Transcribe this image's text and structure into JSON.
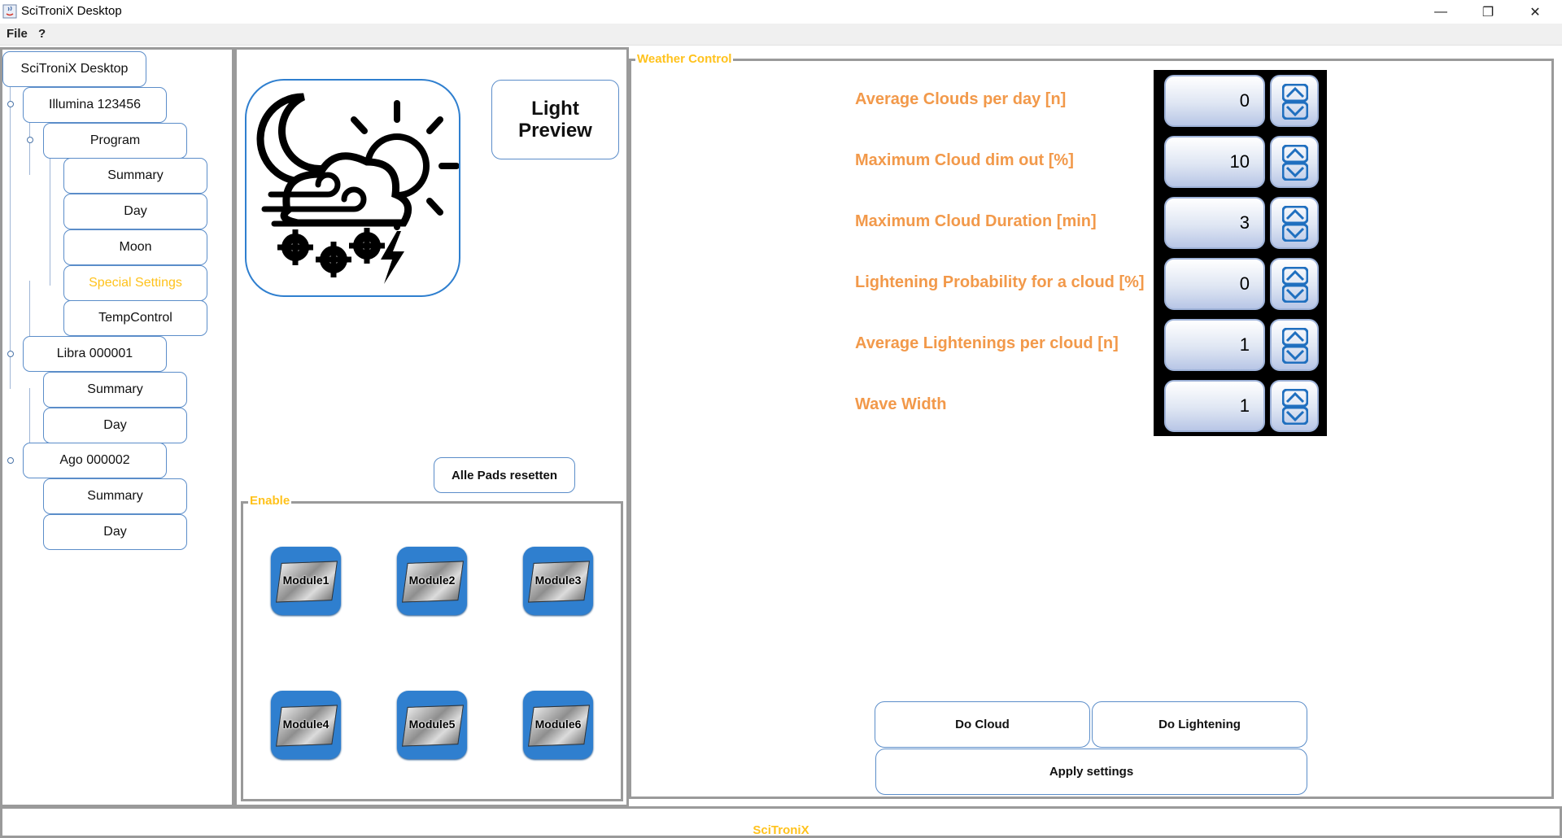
{
  "window": {
    "title": "SciTroniX Desktop",
    "minimize_glyph": "—",
    "maximize_glyph": "❐",
    "close_glyph": "✕"
  },
  "menu": {
    "file": "File",
    "help": "?"
  },
  "tree": {
    "root": "SciTroniX Desktop",
    "illumina": "Illumina 123456",
    "program": "Program",
    "illumina_summary": "Summary",
    "illumina_day": "Day",
    "illumina_moon": "Moon",
    "illumina_special": "Special Settings",
    "illumina_temp": "TempControl",
    "libra": "Libra 000001",
    "libra_summary": "Summary",
    "libra_day": "Day",
    "ago": "Ago 000002",
    "ago_summary": "Summary",
    "ago_day": "Day",
    "selected_color": "#ffc21c"
  },
  "center": {
    "light_preview_line1": "Light",
    "light_preview_line2": "Preview",
    "reset_pads": "Alle Pads resetten",
    "enable_legend": "Enable",
    "modules": [
      "Module1",
      "Module2",
      "Module3",
      "Module4",
      "Module5",
      "Module6"
    ]
  },
  "weather": {
    "legend": "Weather Control",
    "rows": [
      {
        "label": "Average Clouds per day [n]",
        "value": "0"
      },
      {
        "label": "Maximum Cloud dim out [%]",
        "value": "10"
      },
      {
        "label": "Maximum Cloud Duration [min]",
        "value": "3"
      },
      {
        "label": "Lightening Probability for a cloud [%]",
        "value": "0"
      },
      {
        "label": "Average Lightenings per cloud [n]",
        "value": "1"
      },
      {
        "label": "Wave Width",
        "value": "1"
      }
    ],
    "do_cloud": "Do Cloud",
    "do_lightening": "Do Lightening",
    "apply": "Apply settings"
  },
  "status": {
    "text": "SciTroniX"
  },
  "colors": {
    "accent_orange": "#f2994a",
    "legend_yellow": "#ffc21c",
    "module_blue": "#2f7fcf",
    "border_blue": "#5b8dc9"
  }
}
